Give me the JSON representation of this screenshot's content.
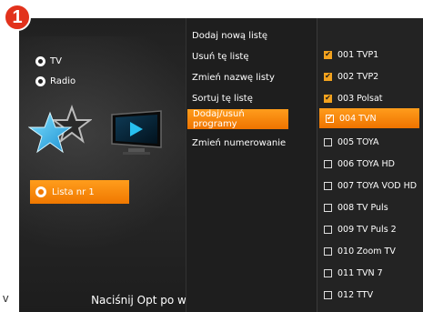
{
  "step_badge": "1",
  "edge_char": "v",
  "left_panel": {
    "sources": [
      {
        "label": "TV",
        "icon": "tv-radio-icon"
      },
      {
        "label": "Radio",
        "icon": "radio-radio-icon"
      }
    ],
    "list_button": {
      "label": "Lista nr 1"
    },
    "footer_hint": "Naciśnij Opt po więcej opcji"
  },
  "menu": {
    "items": [
      {
        "label": "Dodaj nową listę",
        "active": false
      },
      {
        "label": "Usuń tę listę",
        "active": false
      },
      {
        "label": "Zmień nazwę listy",
        "active": false
      },
      {
        "label": "Sortuj tę listę",
        "active": false
      },
      {
        "label": "Dodaj/usuń programy",
        "active": true
      },
      {
        "label": "Zmień numerowanie",
        "active": false
      }
    ]
  },
  "channels": {
    "items": [
      {
        "label": "001 TVP1",
        "checked": true,
        "active": false
      },
      {
        "label": "002 TVP2",
        "checked": true,
        "active": false
      },
      {
        "label": "003 Polsat",
        "checked": true,
        "active": false
      },
      {
        "label": "004 TVN",
        "checked": true,
        "active": true
      },
      {
        "label": "005 TOYA",
        "checked": false,
        "active": false
      },
      {
        "label": "006 TOYA HD",
        "checked": false,
        "active": false
      },
      {
        "label": "007 TOYA VOD HD",
        "checked": false,
        "active": false
      },
      {
        "label": "008 TV Puls",
        "checked": false,
        "active": false
      },
      {
        "label": "009 TV Puls 2",
        "checked": false,
        "active": false
      },
      {
        "label": "010 Zoom TV",
        "checked": false,
        "active": false
      },
      {
        "label": "011 TVN 7",
        "checked": false,
        "active": false
      },
      {
        "label": "012 TTV",
        "checked": false,
        "active": false
      }
    ]
  },
  "colors": {
    "accent": "#f07800",
    "badge": "#e2321c",
    "background": "#161616"
  }
}
